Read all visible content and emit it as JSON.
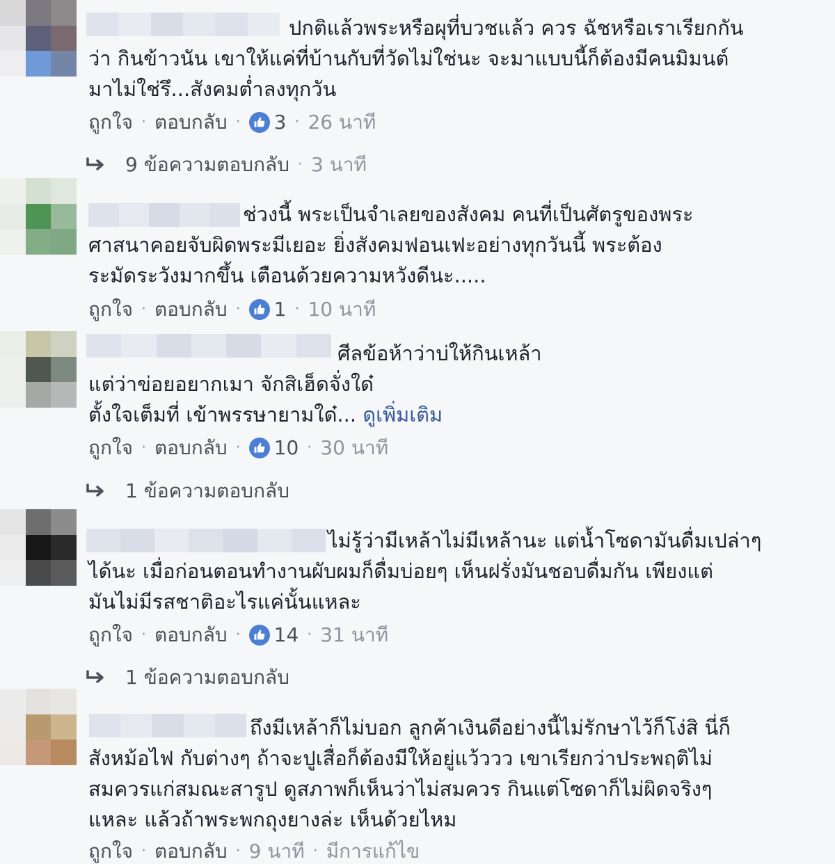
{
  "comments": [
    {
      "text_first": "ปกติแล้วพระหรือผุที่บวชแล้ว ควร ฉัชหรือเราเรียกกัน",
      "text_rest": "ว่า กินข้าวนัน เขาให้แค่ที่บ้านกับที่วัดไม่ใช่นะ จะมาแบบนี้ก็ต้องมีคนมิมนต์\nมาไม่ใช่รึ...สังคมต่ำลงทุกวัน",
      "like_label": "ถูกใจ",
      "reply_label": "ตอบกลับ",
      "reaction_count": "3",
      "time": "26 นาที",
      "replies_label": "9 ข้อความตอบกลับ",
      "replies_time": "3 นาที"
    },
    {
      "text_first": "ช่วงนี้ พระเป็นจำเลยของสังคม คนที่เป็นศัตรูของพระ",
      "text_rest": "ศาสนาคอยจับผิดพระมีเยอะ ยิ่งสังคมฟอนเฟะอย่างทุกวันนี้ พระต้อง\nระมัดระวังมากขึ้น เตือนด้วยความหวังดีนะ.....",
      "like_label": "ถูกใจ",
      "reply_label": "ตอบกลับ",
      "reaction_count": "1",
      "time": "10 นาที"
    },
    {
      "text_first": "ศีลข้อห้าว่าบ่ให้กินเหล้า",
      "text_rest": "แต่ว่าข่อยอยากเมา จักสิเฮ็ดจั่งใด๋\nตั้งใจเต็มที่ เข้าพรรษายามใด๋...",
      "see_more": "ดูเพิ่มเติม",
      "like_label": "ถูกใจ",
      "reply_label": "ตอบกลับ",
      "reaction_count": "10",
      "time": "30 นาที",
      "replies_label": "1 ข้อความตอบกลับ"
    },
    {
      "text_first": "ไม่รู้ว่ามีเหล้าไม่มีเหล้านะ แต่น้ำโซดามันดื่มเปล่าๆ",
      "text_rest": "ได้นะ เมื่อก่อนตอนทำงานผับผมก็ดื่มบ่อยๆ เห็นฝรั่งมันชอบดื่มกัน เพียงแต่\nมันไม่มีรสชาติอะไรแค่นั้นแหละ",
      "like_label": "ถูกใจ",
      "reply_label": "ตอบกลับ",
      "reaction_count": "14",
      "time": "31 นาที",
      "replies_label": "1 ข้อความตอบกลับ"
    },
    {
      "text_first": "ถึงมีเหล้าก็ไม่บอก ลูกค้าเงินดีอย่างนี้ไม่รักษาไว้ก็โง่สิ นี่ก็",
      "text_rest": "สังหม้อไฟ กับต่างๆ ถ้าจะปูเสื่อก็ต้องมีให้อยู่แว้ววว เขาเรียกว่าประพฤติไม่\nสมควรแก่สมณะสารูป ดูสภาพก็เห็นว่าไม่สมควร กินแต่โซดาก็ไม่ผิดจริงๆ\nแหละ แล้วถ้าพระพกถุงยางล่ะ เห็นด้วยไหม",
      "like_label": "ถูกใจ",
      "reply_label": "ตอบกลับ",
      "time": "9 นาที",
      "edited_label": "มีการแก้ไข"
    }
  ],
  "colors": {
    "background": "#f6f7f9",
    "text": "#1d2129",
    "meta": "#90949c",
    "link": "#4b4f56",
    "like_blue": "#4a7fd3",
    "see_more": "#365899"
  },
  "icons": [
    "thumbs-up-icon",
    "reply-arrow-icon"
  ]
}
